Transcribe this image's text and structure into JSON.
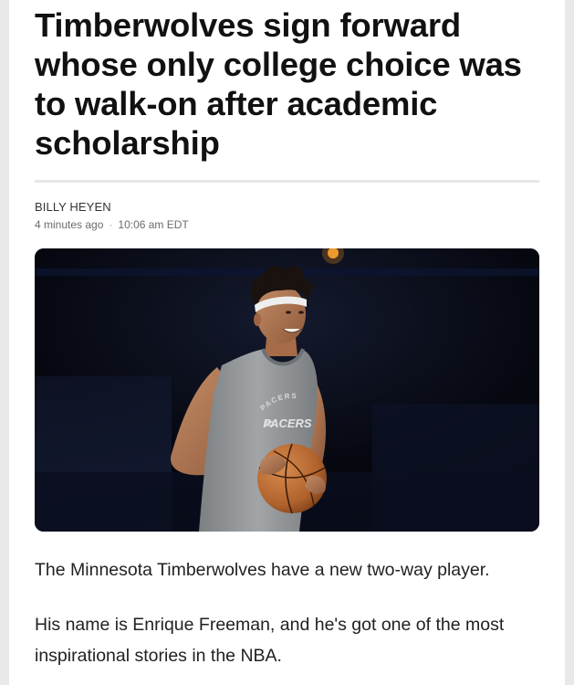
{
  "article": {
    "headline": "Timberwolves sign forward whose only college choice was to walk-on after academic scholarship",
    "author": "BILLY HEYEN",
    "published_relative": "4 minutes ago",
    "published_time": "10:06 am EDT",
    "separator": "·",
    "image": {
      "jersey_text": "PACERS",
      "jersey_arc_text": "PACERS"
    },
    "paragraphs": [
      "The Minnesota Timberwolves have a new two-way player.",
      "His name is Enrique Freeman, and he's got one of the most inspirational stories in the NBA."
    ]
  },
  "colors": {
    "headline": "#111111",
    "meta": "#6b6b6b",
    "jersey": "#8f9294",
    "ball": "#c4763b",
    "background": "#05060c"
  }
}
